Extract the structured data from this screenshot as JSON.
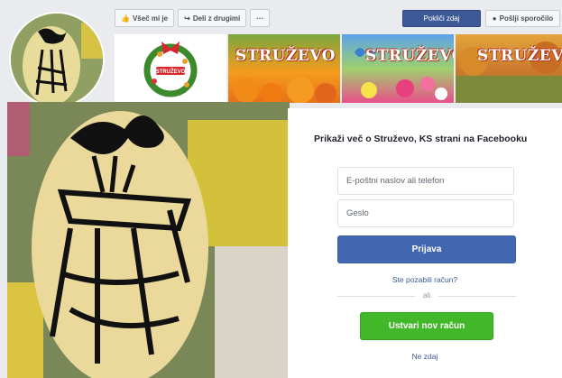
{
  "page": {
    "buttons": {
      "like": "Všeč mi je",
      "share": "Deli z drugimi",
      "more": "···",
      "call": "Pokliči zdaj",
      "message": "Pošlji sporočilo"
    },
    "thumbnails": [
      {
        "title": ""
      },
      {
        "title": "STRUŽEVO"
      },
      {
        "title": "STRUŽEVO"
      },
      {
        "title": "STRUŽEVO"
      }
    ],
    "badge_text": "STRUŽEVO"
  },
  "login_modal": {
    "title": "Prikaži več o Struževo, KS strani na Facebooku",
    "email_placeholder": "E-poštni naslov ali telefon",
    "password_placeholder": "Geslo",
    "login_label": "Prijava",
    "forgot_link": "Ste pozabili račun?",
    "or_text": "ali",
    "create_label": "Ustvari nov račun",
    "not_now": "Ne zdaj"
  },
  "colors": {
    "facebook_blue": "#4267b2",
    "create_green": "#42b72a",
    "link_blue": "#385898"
  },
  "icons": [
    "thumbs-up-icon",
    "share-arrow-icon",
    "messenger-icon"
  ]
}
